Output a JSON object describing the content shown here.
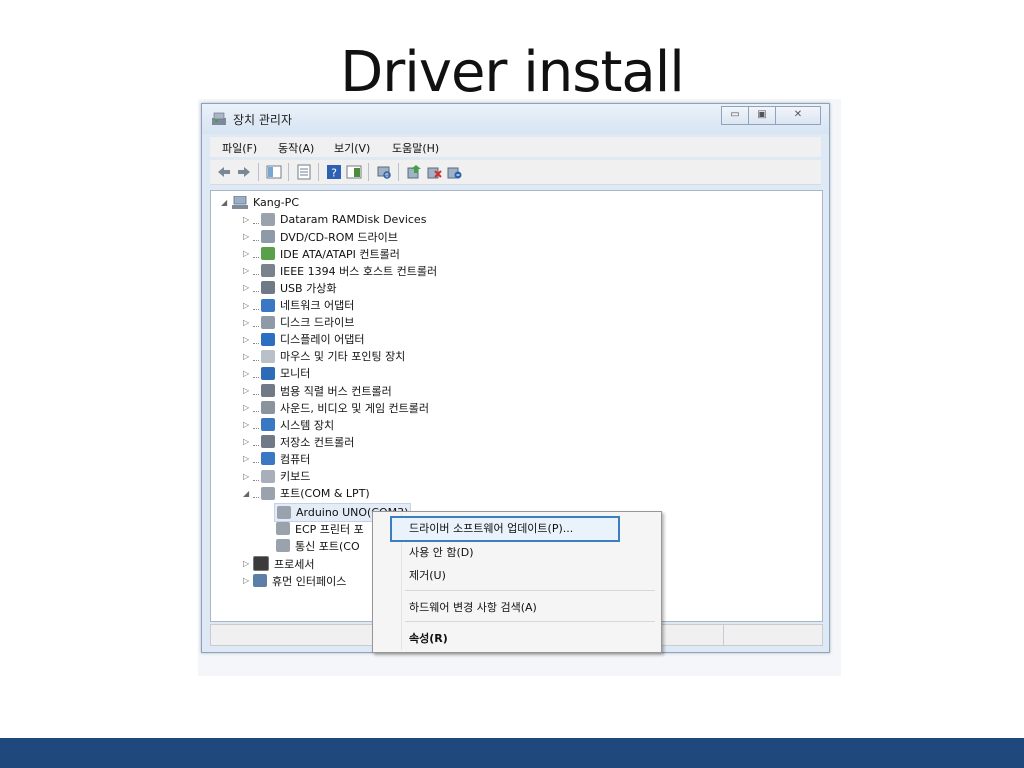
{
  "slide": {
    "title": "Driver install"
  },
  "window": {
    "title": "장치 관리자",
    "min_label": "▭",
    "max_label": "▣",
    "close_label": "✕"
  },
  "menubar": {
    "items": [
      "파일(F)",
      "동작(A)",
      "보기(V)",
      "도움말(H)"
    ]
  },
  "toolbar": {
    "icons": [
      "back-arrow-icon",
      "forward-arrow-icon",
      "show-hide-tree-icon",
      "properties-icon",
      "help-icon",
      "view-icon",
      "scan-hardware-icon",
      "update-driver-icon",
      "disable-device-icon",
      "uninstall-device-icon"
    ]
  },
  "tree": {
    "root": "Kang-PC",
    "categories": [
      "Dataram RAMDisk Devices",
      "DVD/CD-ROM 드라이브",
      "IDE ATA/ATAPI 컨트롤러",
      "IEEE 1394 버스 호스트 컨트롤러",
      "USB 가상화",
      "네트워크 어댑터",
      "디스크 드라이브",
      "디스플레이 어댑터",
      "마우스 및 기타 포인팅 장치",
      "모니터",
      "범용 직렬 버스 컨트롤러",
      "사운드, 비디오 및 게임 컨트롤러",
      "시스템 장치",
      "저장소 컨트롤러",
      "컴퓨터",
      "키보드",
      "포트(COM & LPT)"
    ],
    "ports": [
      "Arduino UNO(COM3)",
      "ECP 프린터 포",
      "통신 포트(CO"
    ],
    "after": [
      "프로세서",
      "휴먼 인터페이스"
    ]
  },
  "context_menu": {
    "update_driver": "드라이버 소프트웨어 업데이트(P)...",
    "disable": "사용 안 함(D)",
    "uninstall": "제거(U)",
    "scan": "하드웨어 변경 사항 검색(A)",
    "properties": "속성(R)"
  },
  "colors": {
    "footer": "#1f497d",
    "highlight_border": "#3c7fc1"
  }
}
